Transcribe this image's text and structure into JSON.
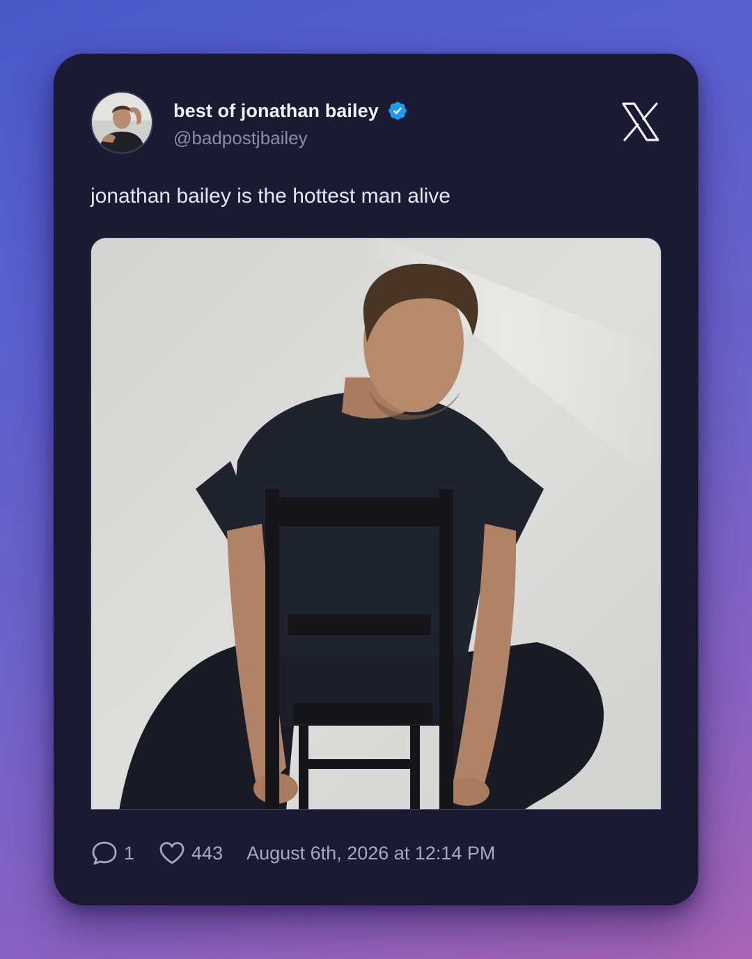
{
  "tweet": {
    "author": {
      "display_name": "best of jonathan bailey",
      "handle": "@badpostjbailey",
      "verified": true
    },
    "text": "jonathan bailey is the hottest man alive",
    "media": {
      "kind": "photo"
    },
    "stats": {
      "replies": "1",
      "likes": "443"
    },
    "timestamp": "August 6th, 2026 at 12:14 PM"
  },
  "icons": {
    "platform": "x-logo-icon",
    "verified": "verified-badge-icon",
    "reply": "comment-bubble-icon",
    "like": "heart-icon"
  },
  "colors": {
    "card_background": "#1b1a33",
    "verified_badge": "#1d9bf0",
    "primary_text": "#f2f2f7",
    "secondary_text": "#8d8ca6"
  }
}
